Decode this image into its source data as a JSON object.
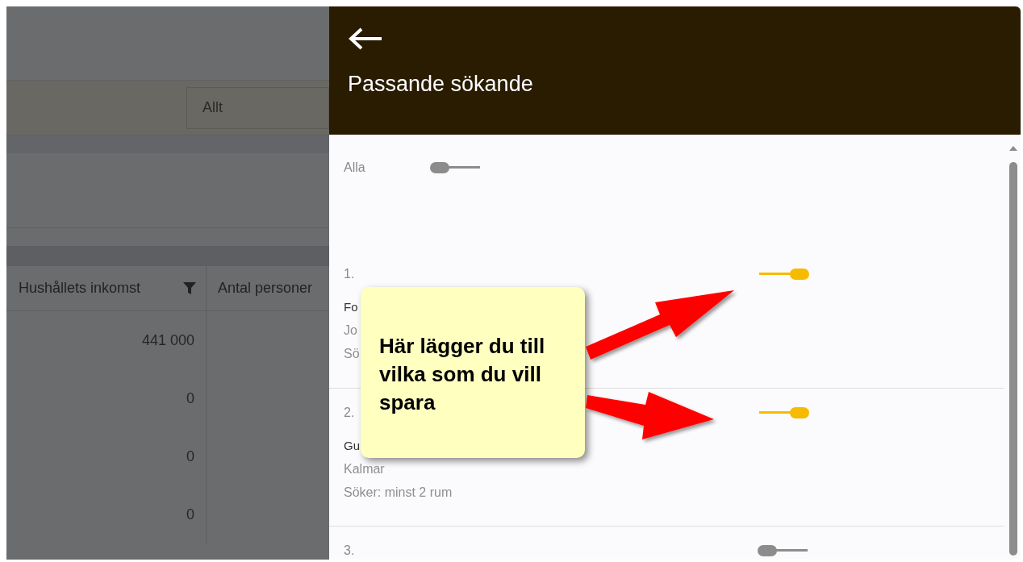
{
  "background_page": {
    "filter_field": {
      "value": "Allt"
    },
    "table": {
      "columns": [
        {
          "label": "Hushållets inkomst",
          "filter": true
        },
        {
          "label": "Antal personer",
          "filter": false
        }
      ],
      "rows": [
        [
          "441 000"
        ],
        [
          "0"
        ],
        [
          "0"
        ],
        [
          "0"
        ]
      ]
    }
  },
  "panel": {
    "title": "Passande sökande",
    "all_toggle": {
      "label": "Alla",
      "on": false
    },
    "candidates": [
      {
        "number": "1.",
        "on": true,
        "lines": [
          "Fo",
          "Jo",
          "Sö"
        ]
      },
      {
        "number": "2.",
        "on": true,
        "lines": [
          "Gu",
          "Kalmar",
          "Söker: minst 2 rum"
        ]
      },
      {
        "number": "3.",
        "on": false
      }
    ]
  },
  "callout": {
    "text": "Här lägger du till vilka som du vill spara"
  }
}
